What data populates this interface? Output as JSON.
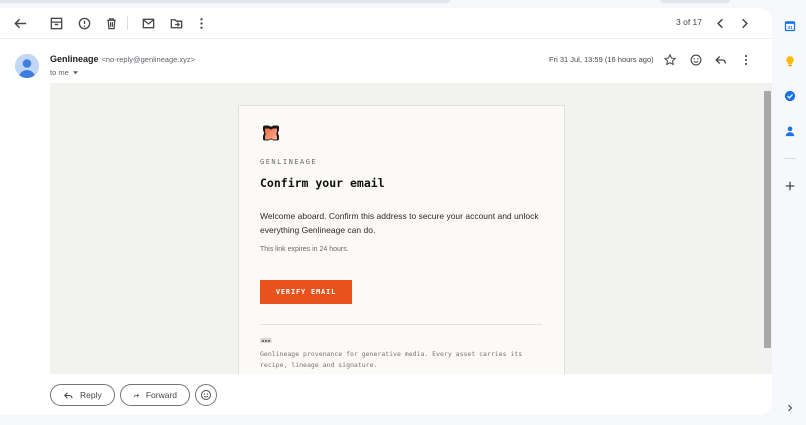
{
  "toolbar": {
    "pager_text": "3 of 17"
  },
  "message": {
    "sender_name": "Genlineage",
    "sender_email": "<no-reply@genlineage.xyz>",
    "to_label": "to me",
    "date": "Fri 31 Jul, 13:59 (16 hours ago)"
  },
  "email": {
    "brand": "GENLINEAGE",
    "headline": "Confirm your email",
    "paragraph": "Welcome aboard. Confirm this address to secure your account and unlock everything Genlineage can do.",
    "expiry": "This link expires in 24 hours.",
    "cta_label": "VERIFY EMAIL",
    "footer_text": "Genlineage provenance for generative media. Every asset carries its recipe, lineage and signature."
  },
  "actions": {
    "reply_label": "Reply",
    "forward_label": "Forward"
  },
  "colors": {
    "cta": "#e8521c",
    "calendar_blue": "#1a73e8",
    "keep_yellow": "#fbbc04",
    "tasks_blue": "#1a73e8",
    "contacts_blue": "#1a73e8"
  },
  "side_icons": [
    "calendar-icon",
    "keep-icon",
    "tasks-icon",
    "contacts-icon",
    "add-icon",
    "expand-icon"
  ]
}
